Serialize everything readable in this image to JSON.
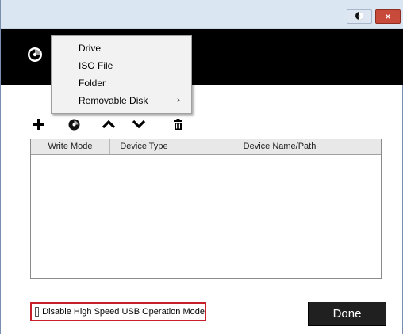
{
  "titlebar": {
    "buttons": [
      {
        "name": "disc-toggle-icon"
      },
      {
        "name": "close-icon",
        "label": "×"
      }
    ]
  },
  "header": {
    "icon": "disc-icon"
  },
  "dropdown_menu": {
    "items": [
      {
        "label": "Drive"
      },
      {
        "label": "ISO File"
      },
      {
        "label": "Folder"
      },
      {
        "label": "Removable Disk",
        "submenu_arrow": "›"
      }
    ]
  },
  "toolbar": {
    "icons": [
      "plus-icon",
      "disc-icon",
      "chevron-up-icon",
      "chevron-down-icon",
      "trash-icon"
    ]
  },
  "table": {
    "columns": [
      "Write Mode",
      "Device Type",
      "Device Name/Path"
    ],
    "rows": []
  },
  "footer": {
    "checkbox_label": "Disable High Speed USB Operation Mode",
    "checkbox_checked": false,
    "done_label": "Done",
    "highlight_color": "#c8202a"
  }
}
